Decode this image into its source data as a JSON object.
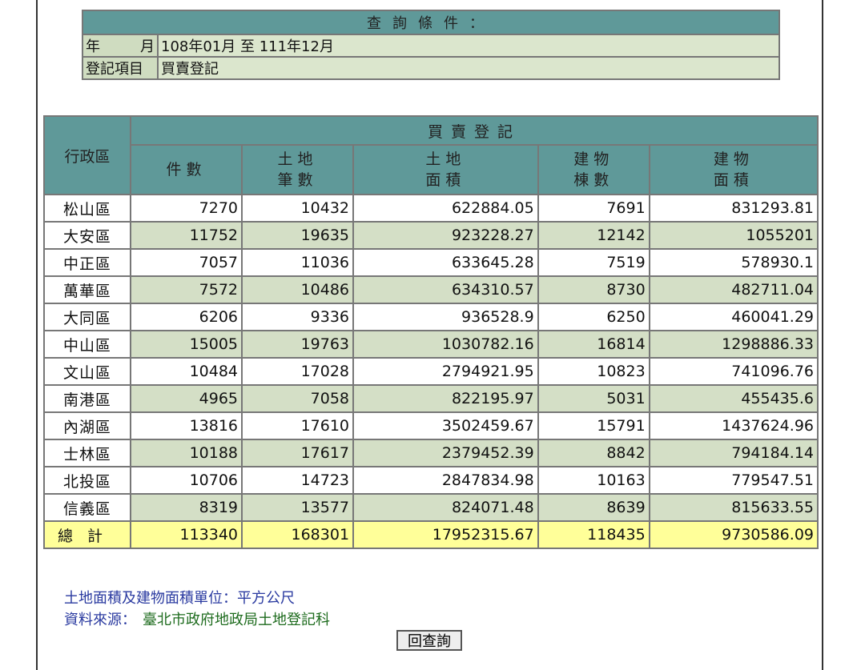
{
  "query": {
    "title": "查詢條件：",
    "rows": [
      {
        "label_a": "年",
        "label_b": "月",
        "value": "108年01月 至 111年12月"
      },
      {
        "label": "登記項目",
        "value": "買賣登記"
      }
    ]
  },
  "table": {
    "district_header": "行政區",
    "group_header": "買賣登記",
    "columns": [
      {
        "line1": "件數",
        "line2": ""
      },
      {
        "line1": "土地",
        "line2": "筆數"
      },
      {
        "line1": "土地",
        "line2": "面積"
      },
      {
        "line1": "建物",
        "line2": "棟數"
      },
      {
        "line1": "建物",
        "line2": "面積"
      }
    ],
    "rows": [
      {
        "district": "松山區",
        "cases": "7270",
        "land_count": "10432",
        "land_area": "622884.05",
        "bldg_count": "7691",
        "bldg_area": "831293.81"
      },
      {
        "district": "大安區",
        "cases": "11752",
        "land_count": "19635",
        "land_area": "923228.27",
        "bldg_count": "12142",
        "bldg_area": "1055201"
      },
      {
        "district": "中正區",
        "cases": "7057",
        "land_count": "11036",
        "land_area": "633645.28",
        "bldg_count": "7519",
        "bldg_area": "578930.1"
      },
      {
        "district": "萬華區",
        "cases": "7572",
        "land_count": "10486",
        "land_area": "634310.57",
        "bldg_count": "8730",
        "bldg_area": "482711.04"
      },
      {
        "district": "大同區",
        "cases": "6206",
        "land_count": "9336",
        "land_area": "936528.9",
        "bldg_count": "6250",
        "bldg_area": "460041.29"
      },
      {
        "district": "中山區",
        "cases": "15005",
        "land_count": "19763",
        "land_area": "1030782.16",
        "bldg_count": "16814",
        "bldg_area": "1298886.33"
      },
      {
        "district": "文山區",
        "cases": "10484",
        "land_count": "17028",
        "land_area": "2794921.95",
        "bldg_count": "10823",
        "bldg_area": "741096.76"
      },
      {
        "district": "南港區",
        "cases": "4965",
        "land_count": "7058",
        "land_area": "822195.97",
        "bldg_count": "5031",
        "bldg_area": "455435.6"
      },
      {
        "district": "內湖區",
        "cases": "13816",
        "land_count": "17610",
        "land_area": "3502459.67",
        "bldg_count": "15791",
        "bldg_area": "1437624.96"
      },
      {
        "district": "士林區",
        "cases": "10188",
        "land_count": "17617",
        "land_area": "2379452.39",
        "bldg_count": "8842",
        "bldg_area": "794184.14"
      },
      {
        "district": "北投區",
        "cases": "10706",
        "land_count": "14723",
        "land_area": "2847834.98",
        "bldg_count": "10163",
        "bldg_area": "779547.51"
      },
      {
        "district": "信義區",
        "cases": "8319",
        "land_count": "13577",
        "land_area": "824071.48",
        "bldg_count": "8639",
        "bldg_area": "815633.55"
      }
    ],
    "total": {
      "district": "總計",
      "cases": "113340",
      "land_count": "168301",
      "land_area": "17952315.67",
      "bldg_count": "118435",
      "bldg_area": "9730586.09"
    }
  },
  "notes": {
    "unit": "土地面積及建物面積單位：平方公尺",
    "source_label": "資料來源：",
    "source_value": "臺北市政府地政局土地登記科"
  },
  "back_button": "回查詢",
  "colors": {
    "header_teal": "#5f9999",
    "row_green": "#d4dfc6",
    "total_yellow": "#ffff99",
    "note_blue": "#2a3aa0",
    "note_green": "#1d6b1d"
  }
}
